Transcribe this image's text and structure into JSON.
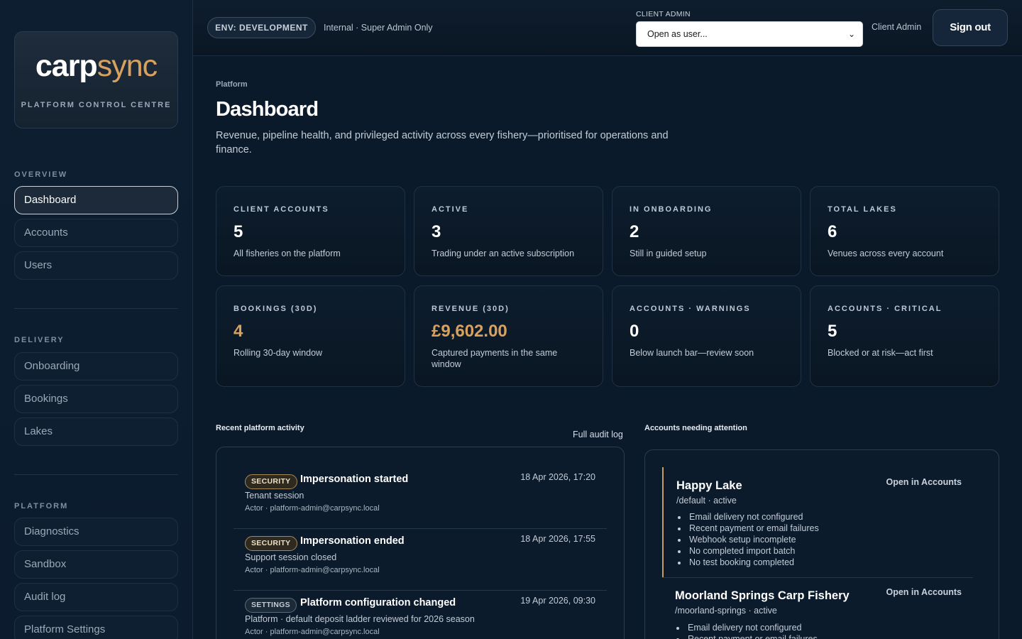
{
  "brand": {
    "logo_a": "carp",
    "logo_b": "sync",
    "subtitle": "PLATFORM CONTROL CENTRE"
  },
  "sidebar": {
    "sections": [
      {
        "label": "OVERVIEW"
      },
      {
        "label": "DELIVERY"
      },
      {
        "label": "PLATFORM"
      }
    ],
    "items": [
      {
        "label": "Dashboard"
      },
      {
        "label": "Accounts"
      },
      {
        "label": "Users"
      },
      {
        "label": "Onboarding"
      },
      {
        "label": "Bookings"
      },
      {
        "label": "Lakes"
      },
      {
        "label": "Diagnostics"
      },
      {
        "label": "Sandbox"
      },
      {
        "label": "Audit log"
      },
      {
        "label": "Platform Settings"
      }
    ]
  },
  "topbar": {
    "env": "ENV: DEVELOPMENT",
    "env_note": "Internal · Super Admin Only",
    "client_label": "CLIENT ADMIN",
    "client_select_value": "Open as user...",
    "client_admin": "Client Admin",
    "signout": "Sign out"
  },
  "page": {
    "crumb": "Platform",
    "title": "Dashboard",
    "subtitle": "Revenue, pipeline health, and privileged activity across every fishery—prioritised for operations and finance."
  },
  "stats": [
    {
      "label": "CLIENT ACCOUNTS",
      "value": "5",
      "desc": "All fisheries on the platform"
    },
    {
      "label": "ACTIVE",
      "value": "3",
      "desc": "Trading under an active subscription"
    },
    {
      "label": "IN ONBOARDING",
      "value": "2",
      "desc": "Still in guided setup"
    },
    {
      "label": "TOTAL LAKES",
      "value": "6",
      "desc": "Venues across every account"
    },
    {
      "label": "BOOKINGS (30D)",
      "value": "4",
      "desc": "Rolling 30-day window"
    },
    {
      "label": "REVENUE (30D)",
      "value": "£9,602.00",
      "desc": "Captured payments in the same window"
    },
    {
      "label": "ACCOUNTS · WARNINGS",
      "value": "0",
      "desc": "Below launch bar—review soon"
    },
    {
      "label": "ACCOUNTS · CRITICAL",
      "value": "5",
      "desc": "Blocked or at risk—act first"
    }
  ],
  "activity": {
    "heading": "Recent platform activity",
    "link": "Full audit log",
    "rows": [
      {
        "badge": "SECURITY",
        "title": "Impersonation started",
        "time": "18 Apr 2026, 17:20",
        "sub": "Tenant session",
        "actor": "Actor · platform-admin@carpsync.local"
      },
      {
        "badge": "SECURITY",
        "title": "Impersonation ended",
        "time": "18 Apr 2026, 17:55",
        "sub": "Support session closed",
        "actor": "Actor · platform-admin@carpsync.local"
      },
      {
        "badge": "SETTINGS",
        "title": "Platform configuration changed",
        "time": "19 Apr 2026, 09:30",
        "sub": "Platform · default deposit ladder reviewed for 2026 season",
        "actor": "Actor · platform-admin@carpsync.local"
      }
    ]
  },
  "attention": {
    "heading": "Accounts needing attention",
    "accounts": [
      {
        "name": "Happy Lake",
        "slug": "/default · active",
        "open": "Open in Accounts",
        "issues": [
          "Email delivery not configured",
          "Recent payment or email failures",
          "Webhook setup incomplete",
          "No completed import batch",
          "No test booking completed"
        ]
      },
      {
        "name": "Moorland Springs Carp Fishery",
        "slug": "/moorland-springs · active",
        "open": "Open in Accounts",
        "issues": [
          "Email delivery not configured",
          "Recent payment or email failures"
        ]
      }
    ]
  },
  "colors": {
    "background": "#0b1a2b",
    "accent_gold": "#d8a25e",
    "text_primary": "#ffffff"
  }
}
